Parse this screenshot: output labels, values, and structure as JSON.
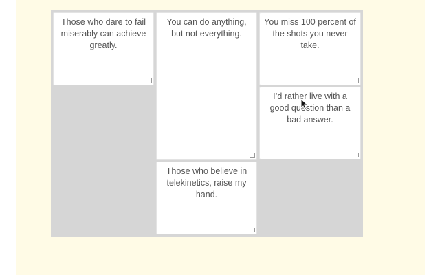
{
  "notes": [
    {
      "text": "Those who dare to fail\nmiserably can achieve\ngreatly."
    },
    {
      "text": "You can do anything,\nbut not everything."
    },
    {
      "text": "You miss 100 percent of\nthe shots you never\ntake."
    },
    {
      "text": "I’d rather live with a\ngood question than a\nbad answer."
    },
    {
      "text": "Those who believe in\ntelekinetics, raise my\nhand."
    }
  ],
  "colors": {
    "page_background": "#fffbe6",
    "board_background": "#d6d6d6",
    "note_background": "#ffffff",
    "note_text": "#555555"
  },
  "icons": {
    "resize_grip": "resize-grip-icon",
    "cursor": "mouse-pointer-icon"
  }
}
